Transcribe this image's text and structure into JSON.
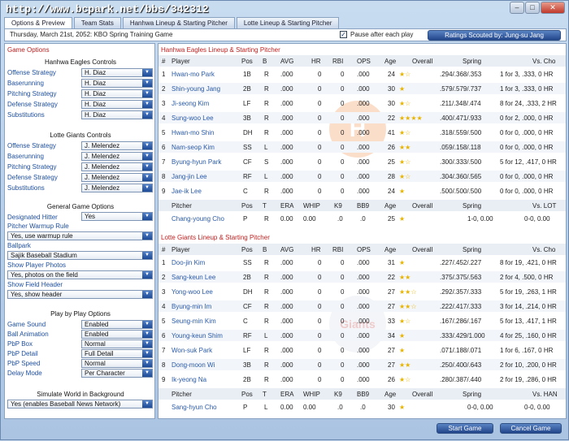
{
  "window": {
    "watermark": "http://www.bcpark.net/bbs/342312"
  },
  "tabs": [
    "Options & Preview",
    "Team Stats",
    "Hanhwa Lineup & Starting Pitcher",
    "Lotte Lineup & Starting Pitcher"
  ],
  "header": {
    "date": "Thursday, March 21st, 2052: KBO Spring Training Game",
    "pause_label": "Pause after each play",
    "pause_checked": "✓",
    "scouted": "Ratings Scouted by: Jung-su Jang"
  },
  "left": {
    "title": "Game Options",
    "hanhwa_title": "Hanhwa Eagles Controls",
    "hanhwa": [
      {
        "label": "Offense Strategy",
        "value": "H. Diaz"
      },
      {
        "label": "Baserunning",
        "value": "H. Diaz"
      },
      {
        "label": "Pitching Strategy",
        "value": "H. Diaz"
      },
      {
        "label": "Defense Strategy",
        "value": "H. Diaz"
      },
      {
        "label": "Substitutions",
        "value": "H. Diaz"
      }
    ],
    "lotte_title": "Lotte Giants Controls",
    "lotte": [
      {
        "label": "Offense Strategy",
        "value": "J. Melendez"
      },
      {
        "label": "Baserunning",
        "value": "J. Melendez"
      },
      {
        "label": "Pitching Strategy",
        "value": "J. Melendez"
      },
      {
        "label": "Defense Strategy",
        "value": "J. Melendez"
      },
      {
        "label": "Substitutions",
        "value": "J. Melendez"
      }
    ],
    "general_title": "General Game Options",
    "dh_label": "Designated Hitter",
    "dh_value": "Yes",
    "warmup_label": "Pitcher Warmup Rule",
    "warmup_value": "Yes, use warmup rule",
    "ballpark_label": "Ballpark",
    "ballpark_value": "Sajik Baseball Stadium",
    "photos_label": "Show Player Photos",
    "photos_value": "Yes, photos on the field",
    "field_label": "Show Field Header",
    "field_value": "Yes, show header",
    "pbp_title": "Play by Play Options",
    "pbp": [
      {
        "label": "Game Sound",
        "value": "Enabled"
      },
      {
        "label": "Ball Animation",
        "value": "Enabled"
      },
      {
        "label": "PbP Box",
        "value": "Normal"
      },
      {
        "label": "PbP Detail",
        "value": "Full Detail"
      },
      {
        "label": "PbP Speed",
        "value": "Normal"
      },
      {
        "label": "Delay Mode",
        "value": "Per Character"
      }
    ],
    "sim_title": "Simulate World in Background",
    "sim_value": "Yes (enables Baseball News Network)"
  },
  "batting_headers": {
    "num": "#",
    "player": "Player",
    "pos": "Pos",
    "b": "B",
    "avg": "AVG",
    "hr": "HR",
    "rbi": "RBI",
    "ops": "OPS",
    "age": "Age",
    "overall": "Overall",
    "spring": "Spring"
  },
  "pitching_headers": {
    "player": "Pitcher",
    "pos": "Pos",
    "t": "T",
    "era": "ERA",
    "whip": "WHIP",
    "k9": "K9",
    "bb9": "BB9",
    "age": "Age",
    "overall": "Overall",
    "spring": "Spring"
  },
  "hanhwa": {
    "title": "Hanhwa Eagles Lineup & Starting Pitcher",
    "vs_label": "Vs. Cho",
    "pvs_label": "Vs. LOT",
    "rows": [
      {
        "n": "1",
        "name": "Hwan-mo Park",
        "pos": "1B",
        "b": "R",
        "avg": ".000",
        "hr": "0",
        "rbi": "0",
        "ops": ".000",
        "age": "24",
        "stars": "★☆",
        "spring": ".294/.368/.353",
        "vs": "1 for 3, .333, 0 HR"
      },
      {
        "n": "2",
        "name": "Shin-young Jang",
        "pos": "2B",
        "b": "R",
        "avg": ".000",
        "hr": "0",
        "rbi": "0",
        "ops": ".000",
        "age": "30",
        "stars": "★",
        "spring": ".579/.579/.737",
        "vs": "1 for 3, .333, 0 HR"
      },
      {
        "n": "3",
        "name": "Ji-seong Kim",
        "pos": "LF",
        "b": "R",
        "avg": ".000",
        "hr": "0",
        "rbi": "0",
        "ops": ".000",
        "age": "30",
        "stars": "★☆",
        "spring": ".211/.348/.474",
        "vs": "8 for 24, .333, 2 HR"
      },
      {
        "n": "4",
        "name": "Sung-woo Lee",
        "pos": "3B",
        "b": "R",
        "avg": ".000",
        "hr": "0",
        "rbi": "0",
        "ops": ".000",
        "age": "22",
        "stars": "★★★★",
        "spring": ".400/.471/.933",
        "vs": "0 for 2, .000, 0 HR"
      },
      {
        "n": "5",
        "name": "Hwan-mo Shin",
        "pos": "DH",
        "b": "R",
        "avg": ".000",
        "hr": "0",
        "rbi": "0",
        "ops": ".000",
        "age": "41",
        "stars": "★☆",
        "spring": ".318/.559/.500",
        "vs": "0 for 0, .000, 0 HR"
      },
      {
        "n": "6",
        "name": "Nam-seop Kim",
        "pos": "SS",
        "b": "L",
        "avg": ".000",
        "hr": "0",
        "rbi": "0",
        "ops": ".000",
        "age": "26",
        "stars": "★★",
        "spring": ".059/.158/.118",
        "vs": "0 for 0, .000, 0 HR"
      },
      {
        "n": "7",
        "name": "Byung-hyun Park",
        "pos": "CF",
        "b": "S",
        "avg": ".000",
        "hr": "0",
        "rbi": "0",
        "ops": ".000",
        "age": "25",
        "stars": "★☆",
        "spring": ".300/.333/.500",
        "vs": "5 for 12, .417, 0 HR"
      },
      {
        "n": "8",
        "name": "Jang-jin Lee",
        "pos": "RF",
        "b": "L",
        "avg": ".000",
        "hr": "0",
        "rbi": "0",
        "ops": ".000",
        "age": "28",
        "stars": "★☆",
        "spring": ".304/.360/.565",
        "vs": "0 for 0, .000, 0 HR"
      },
      {
        "n": "9",
        "name": "Jae-ik Lee",
        "pos": "C",
        "b": "R",
        "avg": ".000",
        "hr": "0",
        "rbi": "0",
        "ops": ".000",
        "age": "24",
        "stars": "★",
        "spring": ".500/.500/.500",
        "vs": "0 for 0, .000, 0 HR"
      }
    ],
    "pitcher": {
      "name": "Chang-young Cho",
      "pos": "P",
      "t": "R",
      "era": "0.00",
      "whip": "0.00",
      "k9": ".0",
      "bb9": ".0",
      "age": "25",
      "stars": "★",
      "spring": "1-0, 0.00",
      "vs": "0-0, 0.00"
    }
  },
  "lotte": {
    "title": "Lotte Giants Lineup & Starting Pitcher",
    "vs_label": "Vs. Cho",
    "pvs_label": "Vs. HAN",
    "rows": [
      {
        "n": "1",
        "name": "Doo-jin Kim",
        "pos": "SS",
        "b": "R",
        "avg": ".000",
        "hr": "0",
        "rbi": "0",
        "ops": ".000",
        "age": "31",
        "stars": "★",
        "spring": ".227/.452/.227",
        "vs": "8 for 19, .421, 0 HR"
      },
      {
        "n": "2",
        "name": "Sang-keun Lee",
        "pos": "2B",
        "b": "R",
        "avg": ".000",
        "hr": "0",
        "rbi": "0",
        "ops": ".000",
        "age": "22",
        "stars": "★★",
        "spring": ".375/.375/.563",
        "vs": "2 for 4, .500, 0 HR"
      },
      {
        "n": "3",
        "name": "Yong-woo Lee",
        "pos": "DH",
        "b": "R",
        "avg": ".000",
        "hr": "0",
        "rbi": "0",
        "ops": ".000",
        "age": "27",
        "stars": "★★☆",
        "spring": ".292/.357/.333",
        "vs": "5 for 19, .263, 1 HR"
      },
      {
        "n": "4",
        "name": "Byung-min Im",
        "pos": "CF",
        "b": "R",
        "avg": ".000",
        "hr": "0",
        "rbi": "0",
        "ops": ".000",
        "age": "27",
        "stars": "★★☆",
        "spring": ".222/.417/.333",
        "vs": "3 for 14, .214, 0 HR"
      },
      {
        "n": "5",
        "name": "Seung-min Kim",
        "pos": "C",
        "b": "R",
        "avg": ".000",
        "hr": "0",
        "rbi": "0",
        "ops": ".000",
        "age": "33",
        "stars": "★☆",
        "spring": ".167/.286/.167",
        "vs": "5 for 13, .417, 1 HR"
      },
      {
        "n": "6",
        "name": "Young-keun Shim",
        "pos": "RF",
        "b": "L",
        "avg": ".000",
        "hr": "0",
        "rbi": "0",
        "ops": ".000",
        "age": "34",
        "stars": "★",
        "spring": ".333/.429/1.000",
        "vs": "4 for 25, .160, 0 HR"
      },
      {
        "n": "7",
        "name": "Won-suk Park",
        "pos": "LF",
        "b": "R",
        "avg": ".000",
        "hr": "0",
        "rbi": "0",
        "ops": ".000",
        "age": "27",
        "stars": "★",
        "spring": ".071/.188/.071",
        "vs": "1 for 6, .167, 0 HR"
      },
      {
        "n": "8",
        "name": "Dong-moon Wi",
        "pos": "3B",
        "b": "R",
        "avg": ".000",
        "hr": "0",
        "rbi": "0",
        "ops": ".000",
        "age": "27",
        "stars": "★★",
        "spring": ".250/.400/.643",
        "vs": "2 for 10, .200, 0 HR"
      },
      {
        "n": "9",
        "name": "Ik-yeong Na",
        "pos": "2B",
        "b": "R",
        "avg": ".000",
        "hr": "0",
        "rbi": "0",
        "ops": ".000",
        "age": "26",
        "stars": "★☆",
        "spring": ".280/.387/.440",
        "vs": "2 for 19, .286, 0 HR"
      }
    ],
    "pitcher": {
      "name": "Sang-hyun Cho",
      "pos": "P",
      "t": "L",
      "era": "0.00",
      "whip": "0.00",
      "k9": ".0",
      "bb9": ".0",
      "age": "30",
      "stars": "★",
      "spring": "0-0, 0.00",
      "vs": "0-0, 0.00"
    }
  },
  "buttons": {
    "start": "Start Game",
    "cancel": "Cancel Game"
  }
}
